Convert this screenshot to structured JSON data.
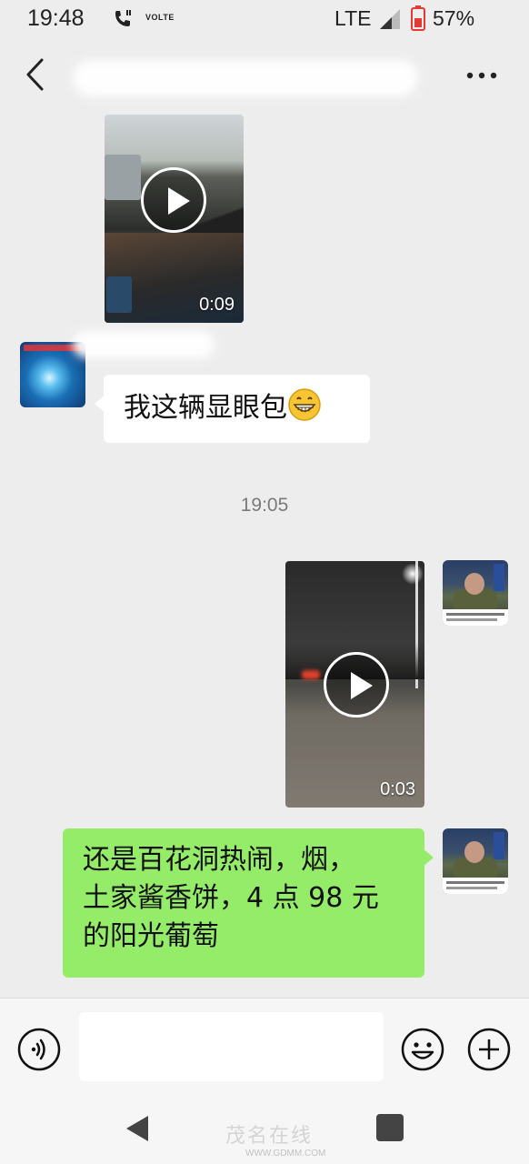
{
  "status_bar": {
    "time": "19:48",
    "network_badge": "VOLTE",
    "network": "LTE",
    "battery": "57%"
  },
  "header": {
    "title": "",
    "back_icon": "chevron-left-icon",
    "more_icon": "more-dots-icon"
  },
  "messages": [
    {
      "type": "video",
      "side": "left",
      "duration": "0:09"
    },
    {
      "type": "text",
      "side": "left",
      "text": "我这辆显眼包",
      "emoji": "grinning-face-emoji"
    },
    {
      "type": "timestamp",
      "text": "19:05"
    },
    {
      "type": "video",
      "side": "right",
      "duration": "0:03"
    },
    {
      "type": "text",
      "side": "right",
      "lines": [
        "还是百花洞热闹，烟，",
        "土家酱香饼，4 点 98 元",
        "的阳光葡萄"
      ]
    }
  ],
  "input_bar": {
    "voice_icon": "voice-icon",
    "input_value": "",
    "emoji_icon": "emoji-icon",
    "plus_icon": "plus-icon"
  },
  "system_nav": {
    "back_icon": "nav-back-icon",
    "home_icon": "nav-home-icon",
    "recent_icon": "nav-recent-icon",
    "watermark": "茂名在线",
    "watermark_url": "WWW.GDMM.COM"
  },
  "colors": {
    "background": "#ededed",
    "my_bubble": "#95ec69",
    "their_bubble": "#ffffff",
    "timestamp_text": "#7a7a7a"
  }
}
